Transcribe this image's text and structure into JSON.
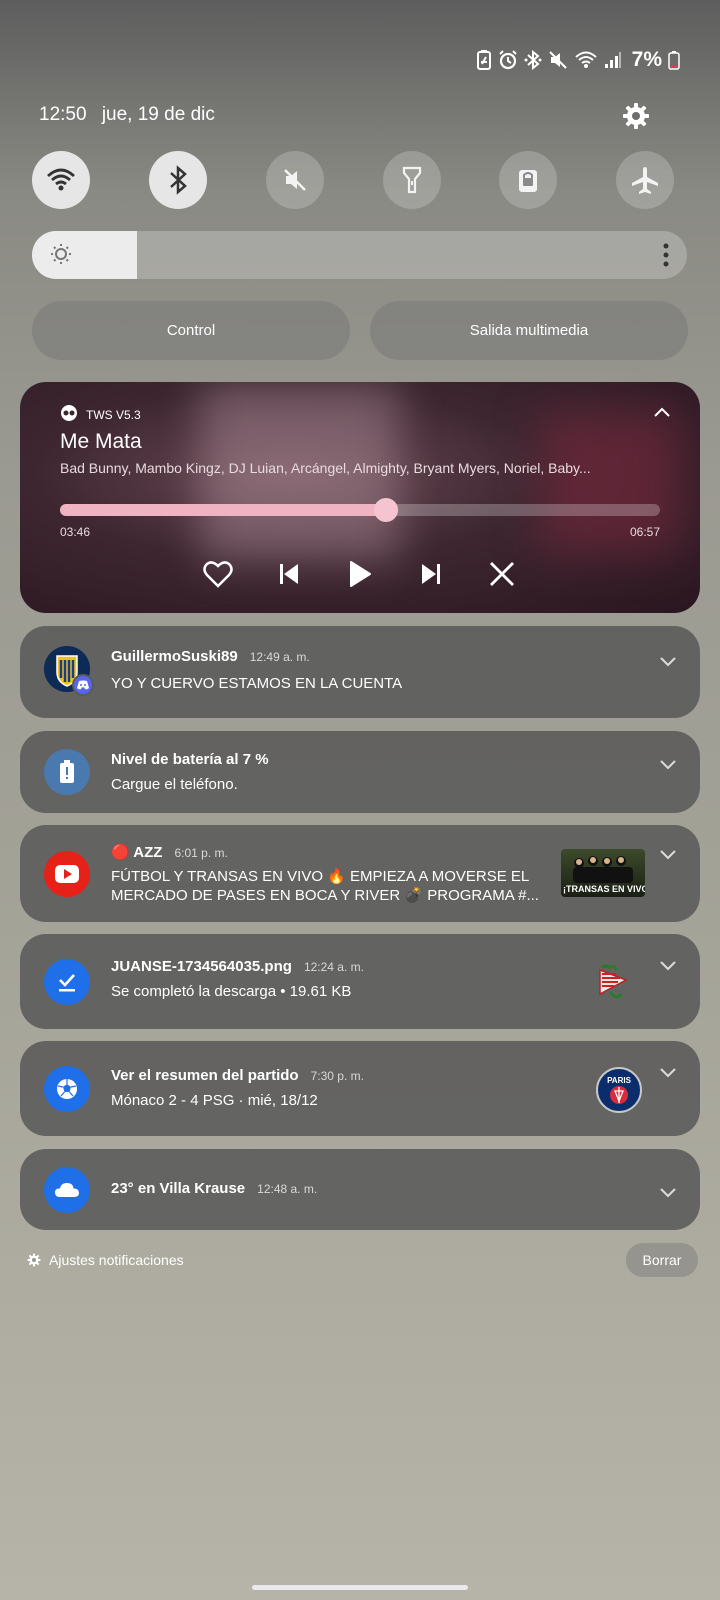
{
  "status_bar": {
    "battery_percent": "7%"
  },
  "header": {
    "time": "12:50",
    "date": "jue, 19 de dic"
  },
  "brightness": {
    "level": 0.16
  },
  "quick_buttons": {
    "control_label": "Control",
    "media_output_label": "Salida multimedia"
  },
  "media": {
    "app_name": "TWS V5.3",
    "title": "Me Mata",
    "artist": "Bad Bunny, Mambo Kingz, DJ Luian, Arcángel, Almighty, Bryant Myers, Noriel, Baby...",
    "current_time": "03:46",
    "total_time": "06:57",
    "progress": 0.543
  },
  "notifications": [
    {
      "title": "GuillermoSuski89",
      "time": "12:49 a. m.",
      "body": "YO Y CUERVO ESTAMOS EN LA CUENTA"
    },
    {
      "title": "Nivel de batería al 7 %",
      "body": "Cargue el teléfono."
    },
    {
      "title": "🔴 AZZ",
      "time": "6:01 p. m.",
      "body": "FÚTBOL Y TRANSAS EN VIVO 🔥 EMPIEZA A MOVERSE EL MERCADO DE PASES EN BOCA Y RIVER 💣 PROGRAMA #...",
      "thumb_text": "¡TRANSAS EN VIVO!"
    },
    {
      "title": "JUANSE-1734564035.png",
      "time": "12:24 a. m.",
      "body": "Se completó la descarga • 19.61 KB"
    },
    {
      "title": "Ver el resumen del partido",
      "time": "7:30 p. m.",
      "body": "Mónaco 2 - 4 PSG · mié, 18/12",
      "thumb_text": "PARIS"
    },
    {
      "title": "23° en Villa Krause",
      "time": "12:48 a. m."
    }
  ],
  "footer": {
    "settings_label": "Ajustes notificaciones",
    "clear_label": "Borrar"
  },
  "colors": {
    "youtube": "#e62117",
    "blue": "#1f6fe8",
    "battery_blue": "#4a79b0",
    "progress": "#f0b3c2"
  }
}
